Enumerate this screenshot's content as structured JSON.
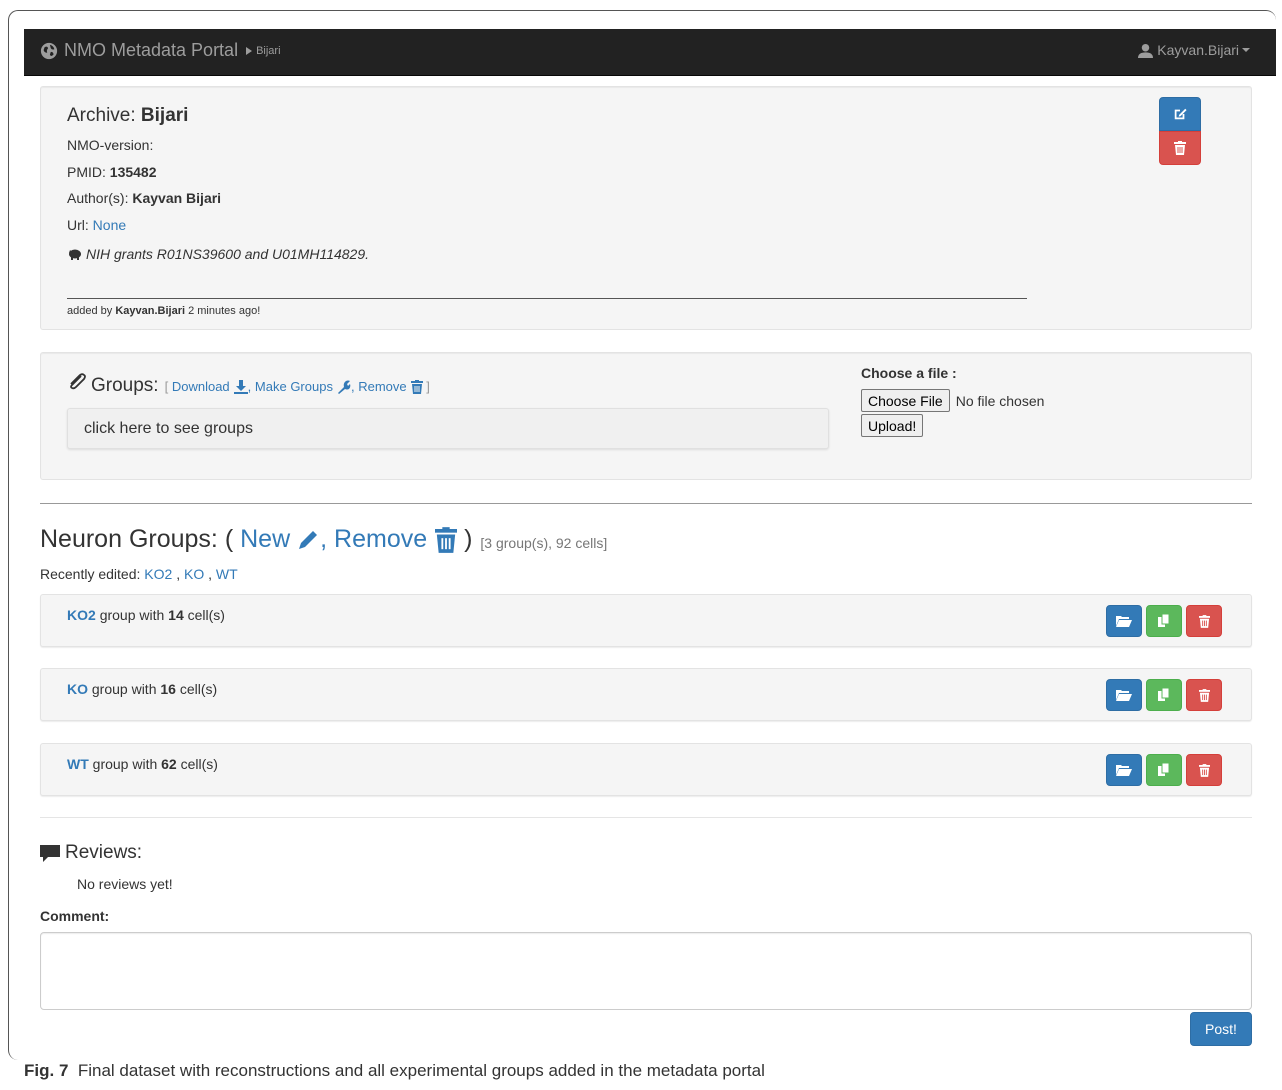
{
  "navbar": {
    "brand": "NMO Metadata Portal",
    "breadcrumb": "Bijari",
    "user": "Kayvan.Bijari"
  },
  "archive": {
    "title_prefix": "Archive:",
    "title_name": "Bijari",
    "nmo_version_label": "NMO-version:",
    "pmid_label": "PMID:",
    "pmid_value": "135482",
    "authors_label": "Author(s):",
    "authors_value": "Kayvan Bijari",
    "url_label": "Url:",
    "url_value": "None",
    "grant_text": "NIH grants R01NS39600 and U01MH114829.",
    "added_prefix": "added by",
    "added_user": "Kayvan.Bijari",
    "added_suffix": "2 minutes ago!"
  },
  "groups_panel": {
    "label": "Groups:",
    "open_bracket": "[",
    "download": "Download",
    "make_groups": "Make Groups",
    "remove": "Remove",
    "close_bracket": "]",
    "sep": ",",
    "box_text": "click here to see groups",
    "file_label": "Choose a file :",
    "choose_file": "Choose File",
    "no_file": "No file chosen",
    "upload": "Upload!"
  },
  "neuron_groups": {
    "title": "Neuron Groups:",
    "open_paren": "(",
    "new_label": "New",
    "comma": ",",
    "remove_label": "Remove",
    "close_paren": ")",
    "count": "[3 group(s), 92 cells]",
    "recent_label": "Recently edited:",
    "recent": [
      "KO2",
      "KO",
      "WT"
    ],
    "items": [
      {
        "name": "KO2",
        "mid": "group with",
        "cells": "14",
        "suffix": "cell(s)"
      },
      {
        "name": "KO",
        "mid": "group with",
        "cells": "16",
        "suffix": "cell(s)"
      },
      {
        "name": "WT",
        "mid": "group with",
        "cells": "62",
        "suffix": "cell(s)"
      }
    ]
  },
  "reviews": {
    "title": "Reviews:",
    "empty": "No reviews yet!",
    "comment_label": "Comment:",
    "comment_value": "",
    "post": "Post!"
  },
  "caption": {
    "fig": "Fig. 7",
    "text": "Final dataset with reconstructions and all experimental groups added in the metadata portal"
  },
  "colors": {
    "primary": "#337ab7",
    "danger": "#d9534f",
    "success": "#5cb85c",
    "navbar": "#222222"
  }
}
